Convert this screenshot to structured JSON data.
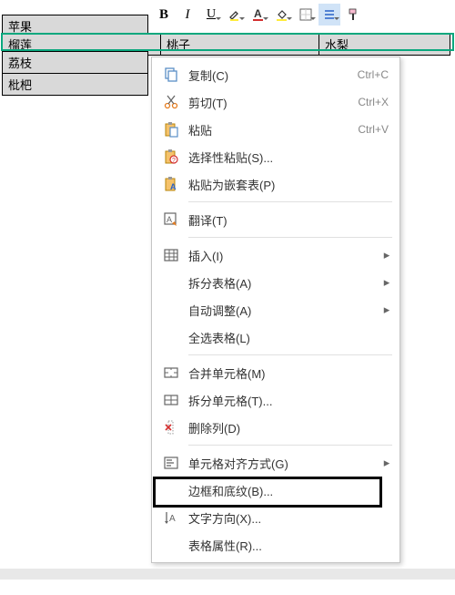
{
  "toolbar": {
    "bold": "B",
    "italic": "I",
    "underline": "U"
  },
  "table": {
    "row1": {
      "c1": "苹果"
    },
    "row2": {
      "c1": "榴莲",
      "c2": "桃子",
      "c3": "水梨"
    },
    "row3": {
      "c1": "荔枝"
    },
    "row4": {
      "c1": "枇杷"
    }
  },
  "menu": {
    "copy": {
      "label": "复制(C)",
      "shortcut": "Ctrl+C"
    },
    "cut": {
      "label": "剪切(T)",
      "shortcut": "Ctrl+X"
    },
    "paste": {
      "label": "粘贴",
      "shortcut": "Ctrl+V"
    },
    "paste_special": {
      "label": "选择性粘贴(S)..."
    },
    "paste_nested": {
      "label": "粘贴为嵌套表(P)"
    },
    "translate": {
      "label": "翻译(T)"
    },
    "insert": {
      "label": "插入(I)"
    },
    "split_table": {
      "label": "拆分表格(A)"
    },
    "auto_fit": {
      "label": "自动调整(A)"
    },
    "select_all": {
      "label": "全选表格(L)"
    },
    "merge_cells": {
      "label": "合并单元格(M)"
    },
    "split_cells": {
      "label": "拆分单元格(T)..."
    },
    "delete_col": {
      "label": "删除列(D)"
    },
    "cell_align": {
      "label": "单元格对齐方式(G)"
    },
    "borders": {
      "label": "边框和底纹(B)..."
    },
    "text_dir": {
      "label": "文字方向(X)..."
    },
    "table_props": {
      "label": "表格属性(R)..."
    }
  }
}
